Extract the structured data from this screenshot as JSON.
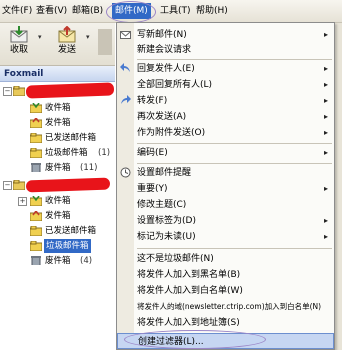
{
  "menubar": {
    "items": [
      "文件(F)",
      "查看(V)",
      "邮箱(B)",
      "邮件(M)",
      "工具(T)",
      "帮助(H)"
    ]
  },
  "toolbar": {
    "receive_label": "收取",
    "send_label": "发送"
  },
  "sidebar": {
    "header": "Foxmail",
    "account1_folders": [
      {
        "label": "收件箱"
      },
      {
        "label": "发件箱"
      },
      {
        "label": "已发送邮件箱"
      },
      {
        "label": "垃圾邮件箱",
        "count": "(1)"
      },
      {
        "label": "废件箱",
        "count": "(11)"
      }
    ],
    "account2_folders": [
      {
        "label": "收件箱"
      },
      {
        "label": "发件箱"
      },
      {
        "label": "已发送邮件箱"
      },
      {
        "label": "垃圾邮件箱"
      },
      {
        "label": "废件箱",
        "count": "(4)"
      }
    ]
  },
  "menu": {
    "items": [
      {
        "label": "写新邮件(N)"
      },
      {
        "label": "新建会议请求"
      },
      {
        "label": "回复发件人(E)"
      },
      {
        "label": "全部回复所有人(L)"
      },
      {
        "label": "转发(F)"
      },
      {
        "label": "再次发送(A)"
      },
      {
        "label": "作为附件发送(O)"
      },
      {
        "label": "编码(E)"
      },
      {
        "label": "设置邮件提醒"
      },
      {
        "label": "重要(Y)"
      },
      {
        "label": "修改主题(C)"
      },
      {
        "label": "设置标签为(D)"
      },
      {
        "label": "标记为未读(U)"
      },
      {
        "label": "这不是垃圾邮件(N)"
      },
      {
        "label": "将发件人加入到黑名单(B)"
      },
      {
        "label": "将发件人加入到白名单(W)"
      },
      {
        "label": "将发件人的域(newsletter.ctrip.com)加入到白名单(N)"
      },
      {
        "label": "将发件人加入到地址簿(S)"
      },
      {
        "label": "创建过滤器(L)..."
      }
    ]
  },
  "colors": {
    "menu_highlight": "#3169c6",
    "annotation_circle": "#9b86c7",
    "redaction": "#e8141a"
  }
}
